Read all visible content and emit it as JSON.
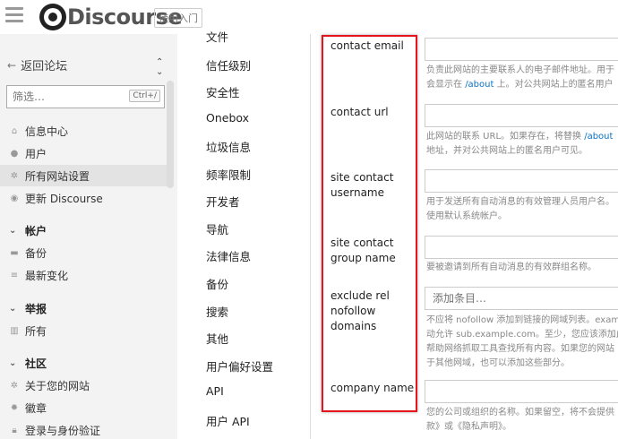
{
  "header": {
    "logo_text": "Discourse",
    "tag": "使用入门"
  },
  "sidebar": {
    "back_label": "返回论坛",
    "filter_placeholder": "筛选…",
    "filter_shortcut": "Ctrl+/",
    "top_items": [
      {
        "label": "信息中心",
        "icon": "home-icon"
      },
      {
        "label": "用户",
        "icon": "users-icon"
      },
      {
        "label": "所有网站设置",
        "icon": "gear-icon"
      },
      {
        "label": "更新 Discourse",
        "icon": "upgrade-icon"
      }
    ],
    "sections": [
      {
        "title": "帐户",
        "items": [
          {
            "label": "备份",
            "icon": "archive-icon"
          },
          {
            "label": "最新变化",
            "icon": "list-icon"
          }
        ]
      },
      {
        "title": "举报",
        "items": [
          {
            "label": "所有",
            "icon": "chart-icon"
          }
        ]
      },
      {
        "title": "社区",
        "items": [
          {
            "label": "关于您的网站",
            "icon": "gear-icon"
          },
          {
            "label": "徽章",
            "icon": "badge-icon"
          },
          {
            "label": "登录与身份验证",
            "icon": "lock-icon"
          }
        ]
      }
    ]
  },
  "categories": [
    "文件",
    "信任级别",
    "安全性",
    "Onebox",
    "垃圾信息",
    "频率限制",
    "开发者",
    "导航",
    "法律信息",
    "备份",
    "搜索",
    "其他",
    "用户偏好设置",
    "API",
    "用户 API"
  ],
  "settings": [
    {
      "label": "contact email",
      "value": "",
      "desc1": "负责此网站的主要联系人的电子邮件地址。用于",
      "desc2a": "会显示在 ",
      "link": "/about",
      "desc2b": " 上。对公共网站上的匿名用户"
    },
    {
      "label": "contact url",
      "value": "",
      "desc1a": "此网站的联系 URL。如果存在，将替换 ",
      "link": "/about",
      "desc2": "地址，并对公共网站上的匿名用户可见。"
    },
    {
      "label": "site contact username",
      "value": "",
      "desc1": "用于发送所有自动消息的有效管理人员用户名。",
      "desc2": "使用默认系统帐户。"
    },
    {
      "label": "site contact group name",
      "value": "",
      "desc1": "要被邀请到所有自动消息的有效群组名称。"
    },
    {
      "label": "exclude rel nofollow domains",
      "placeholder": "添加条目…",
      "desc1": "不应将 nofollow 添加到链接的网域列表。exam",
      "desc2": "动允许 sub.example.com。至少，您应该添加此",
      "desc3": "帮助网络抓取工具查找所有内容。如果您的网站",
      "desc4": "于其他网域，也可以添加这些部分。"
    },
    {
      "label": "company name",
      "value": "",
      "desc1": "您的公司或组织的名称。如果留空，将不会提供",
      "desc2": "款》或《隐私声明》。"
    }
  ],
  "colors": {
    "highlight": "#e4161b",
    "link": "#0a73c2",
    "sidebar_bg": "#f3f3f3"
  }
}
